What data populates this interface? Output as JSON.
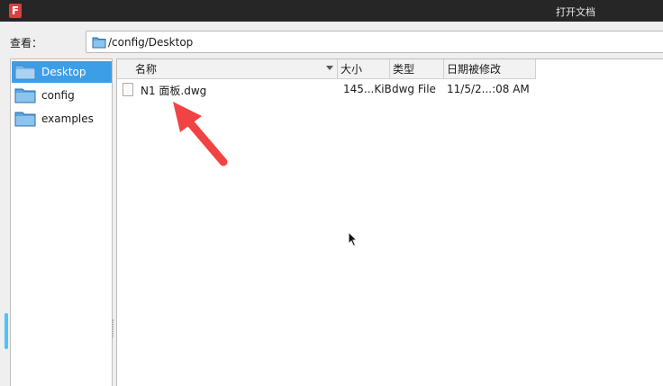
{
  "window": {
    "app_icon_letter": "F",
    "title": "打开文档"
  },
  "toolbar": {
    "look_in_label": "查看：",
    "path": "/config/Desktop"
  },
  "sidebar": {
    "items": [
      {
        "label": "Desktop",
        "selected": true,
        "icon": "folder-icon"
      },
      {
        "label": "config",
        "selected": false,
        "icon": "folder-icon"
      },
      {
        "label": "examples",
        "selected": false,
        "icon": "folder-icon"
      }
    ]
  },
  "filelist": {
    "columns": [
      {
        "label": "名称",
        "sorted": true
      },
      {
        "label": "大小"
      },
      {
        "label": "类型"
      },
      {
        "label": "日期被修改"
      }
    ],
    "rows": [
      {
        "name": "N1 面板.dwg",
        "size": "145...KiB",
        "type": "dwg File",
        "modified": "11/5/2...:08 AM",
        "icon": "file-icon"
      }
    ]
  },
  "colors": {
    "titlebar": "#262626",
    "selection": "#3d9ee8",
    "annotation_arrow": "#f04444"
  }
}
